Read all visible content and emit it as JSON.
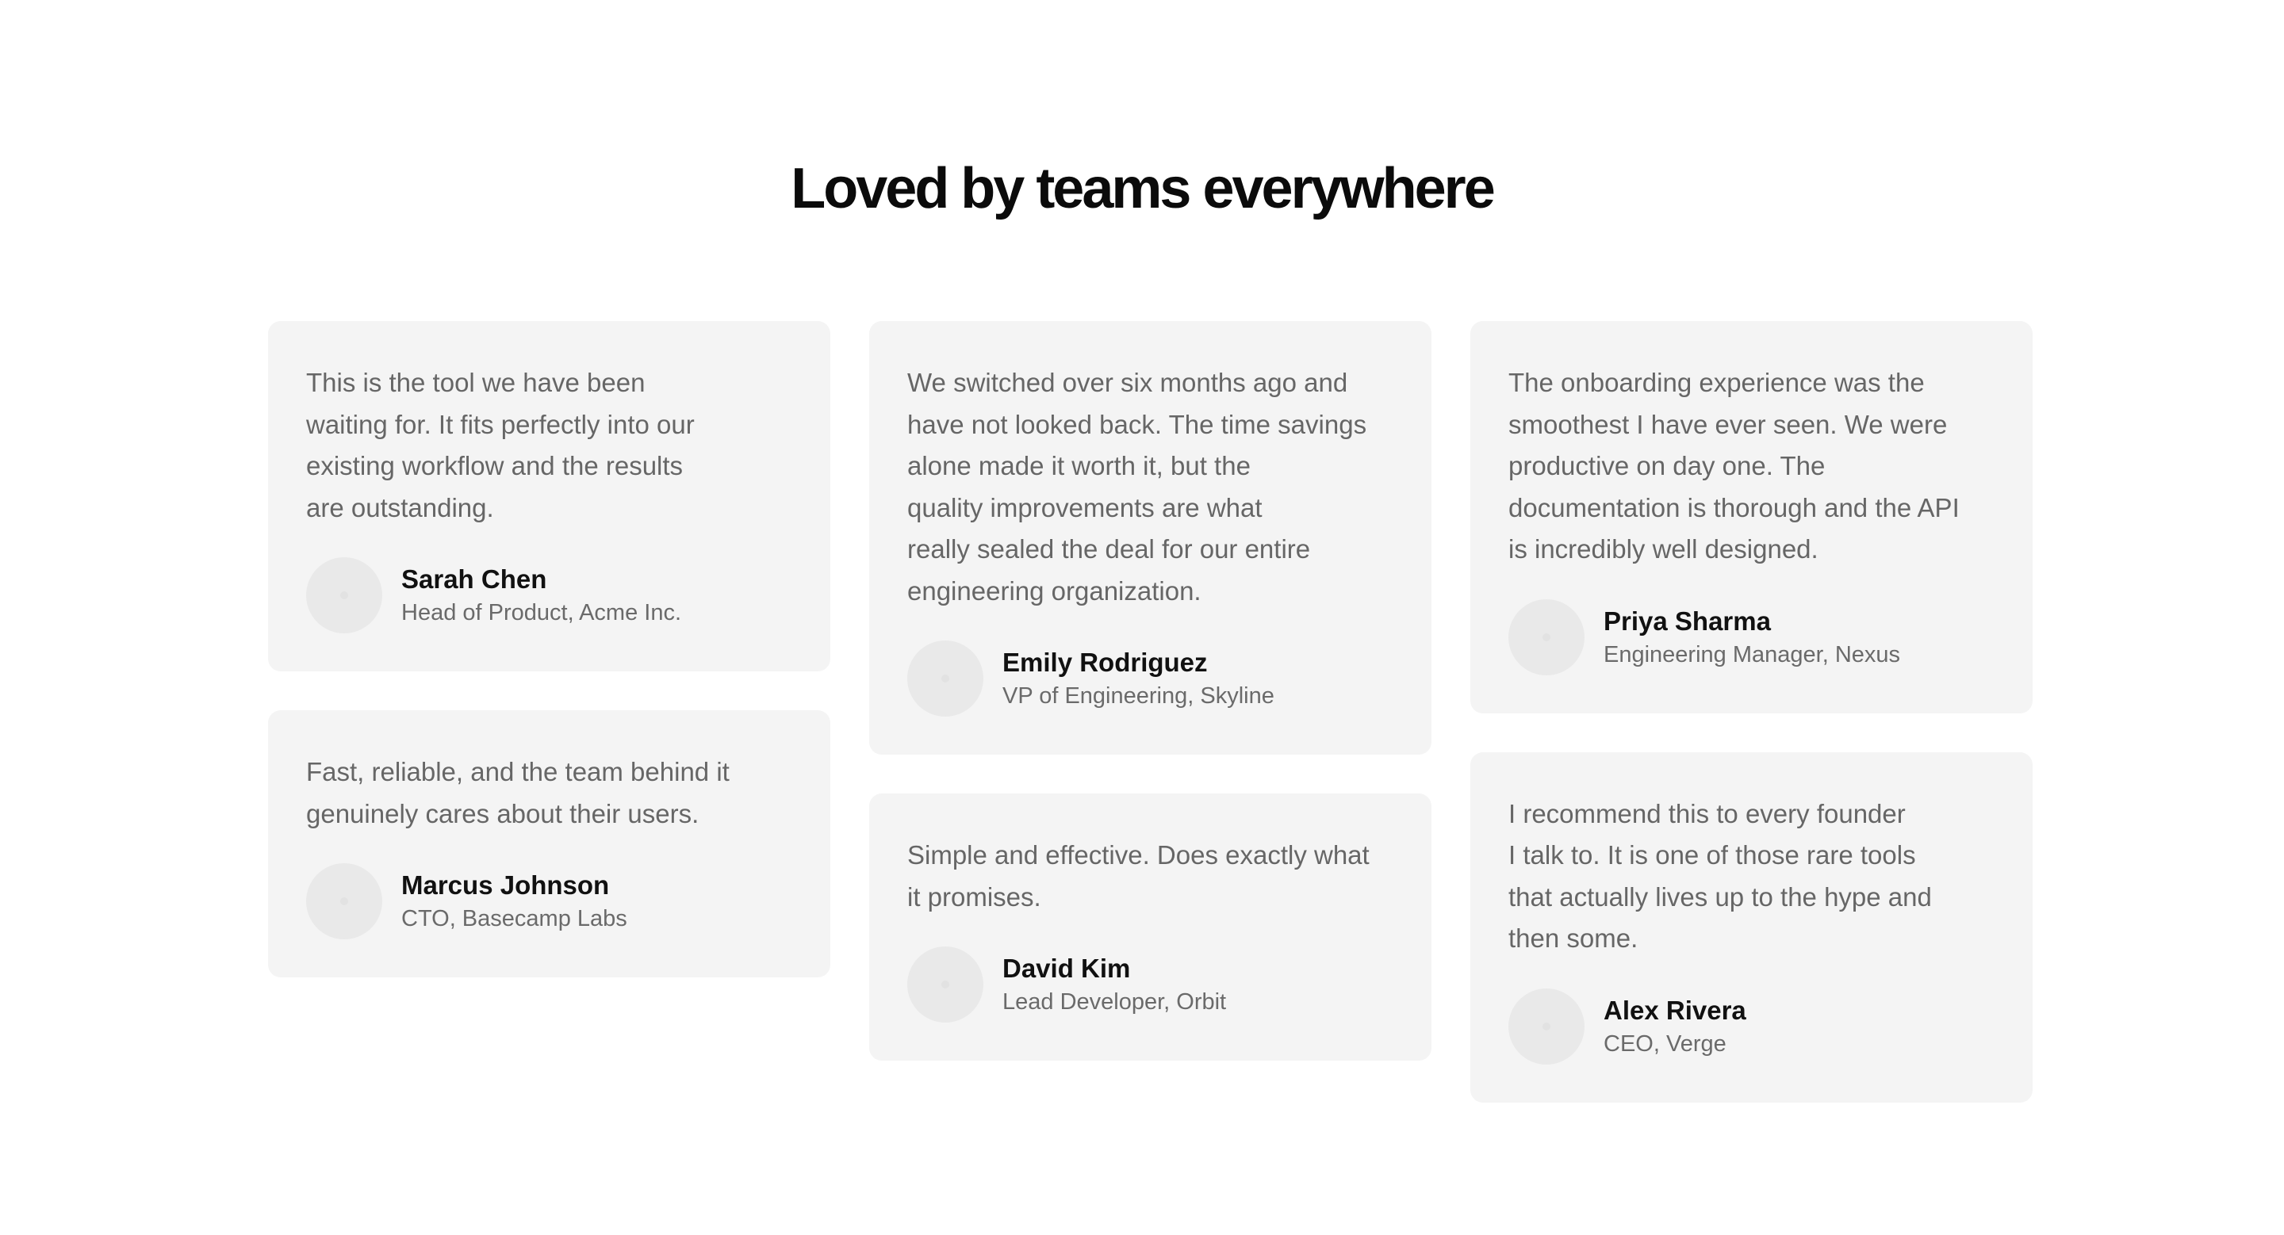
{
  "section": {
    "heading": "Loved by teams everywhere"
  },
  "columns": [
    [
      {
        "quote_lines": [
          "This is the tool we have been",
          "waiting for. It fits perfectly into our",
          "existing workflow and the results",
          "are outstanding."
        ],
        "name": "Sarah Chen",
        "role": "Head of Product, Acme Inc."
      },
      {
        "quote_lines": [
          "Fast, reliable, and the team behind it",
          "genuinely cares about their users."
        ],
        "name": "Marcus Johnson",
        "role": "CTO, Basecamp Labs"
      }
    ],
    [
      {
        "quote_lines": [
          "We switched over six months ago and",
          "have not looked back. The time savings",
          "alone made it worth it, but the",
          "quality improvements are what",
          "really sealed the deal for our entire",
          "engineering organization."
        ],
        "name": "Emily Rodriguez",
        "role": "VP of Engineering, Skyline"
      },
      {
        "quote_lines": [
          "Simple and effective. Does exactly what",
          "it promises."
        ],
        "name": "David Kim",
        "role": "Lead Developer, Orbit"
      }
    ],
    [
      {
        "quote_lines": [
          "The onboarding experience was the",
          "smoothest I have ever seen. We were",
          "productive on day one. The",
          "documentation is thorough and the API",
          "is incredibly well designed."
        ],
        "name": "Priya Sharma",
        "role": "Engineering Manager, Nexus"
      },
      {
        "quote_lines": [
          "I recommend this to every founder",
          "I talk to. It is one of those rare tools",
          "that actually lives up to the hype and",
          "then some."
        ],
        "name": "Alex Rivera",
        "role": "CEO, Verge"
      }
    ]
  ]
}
